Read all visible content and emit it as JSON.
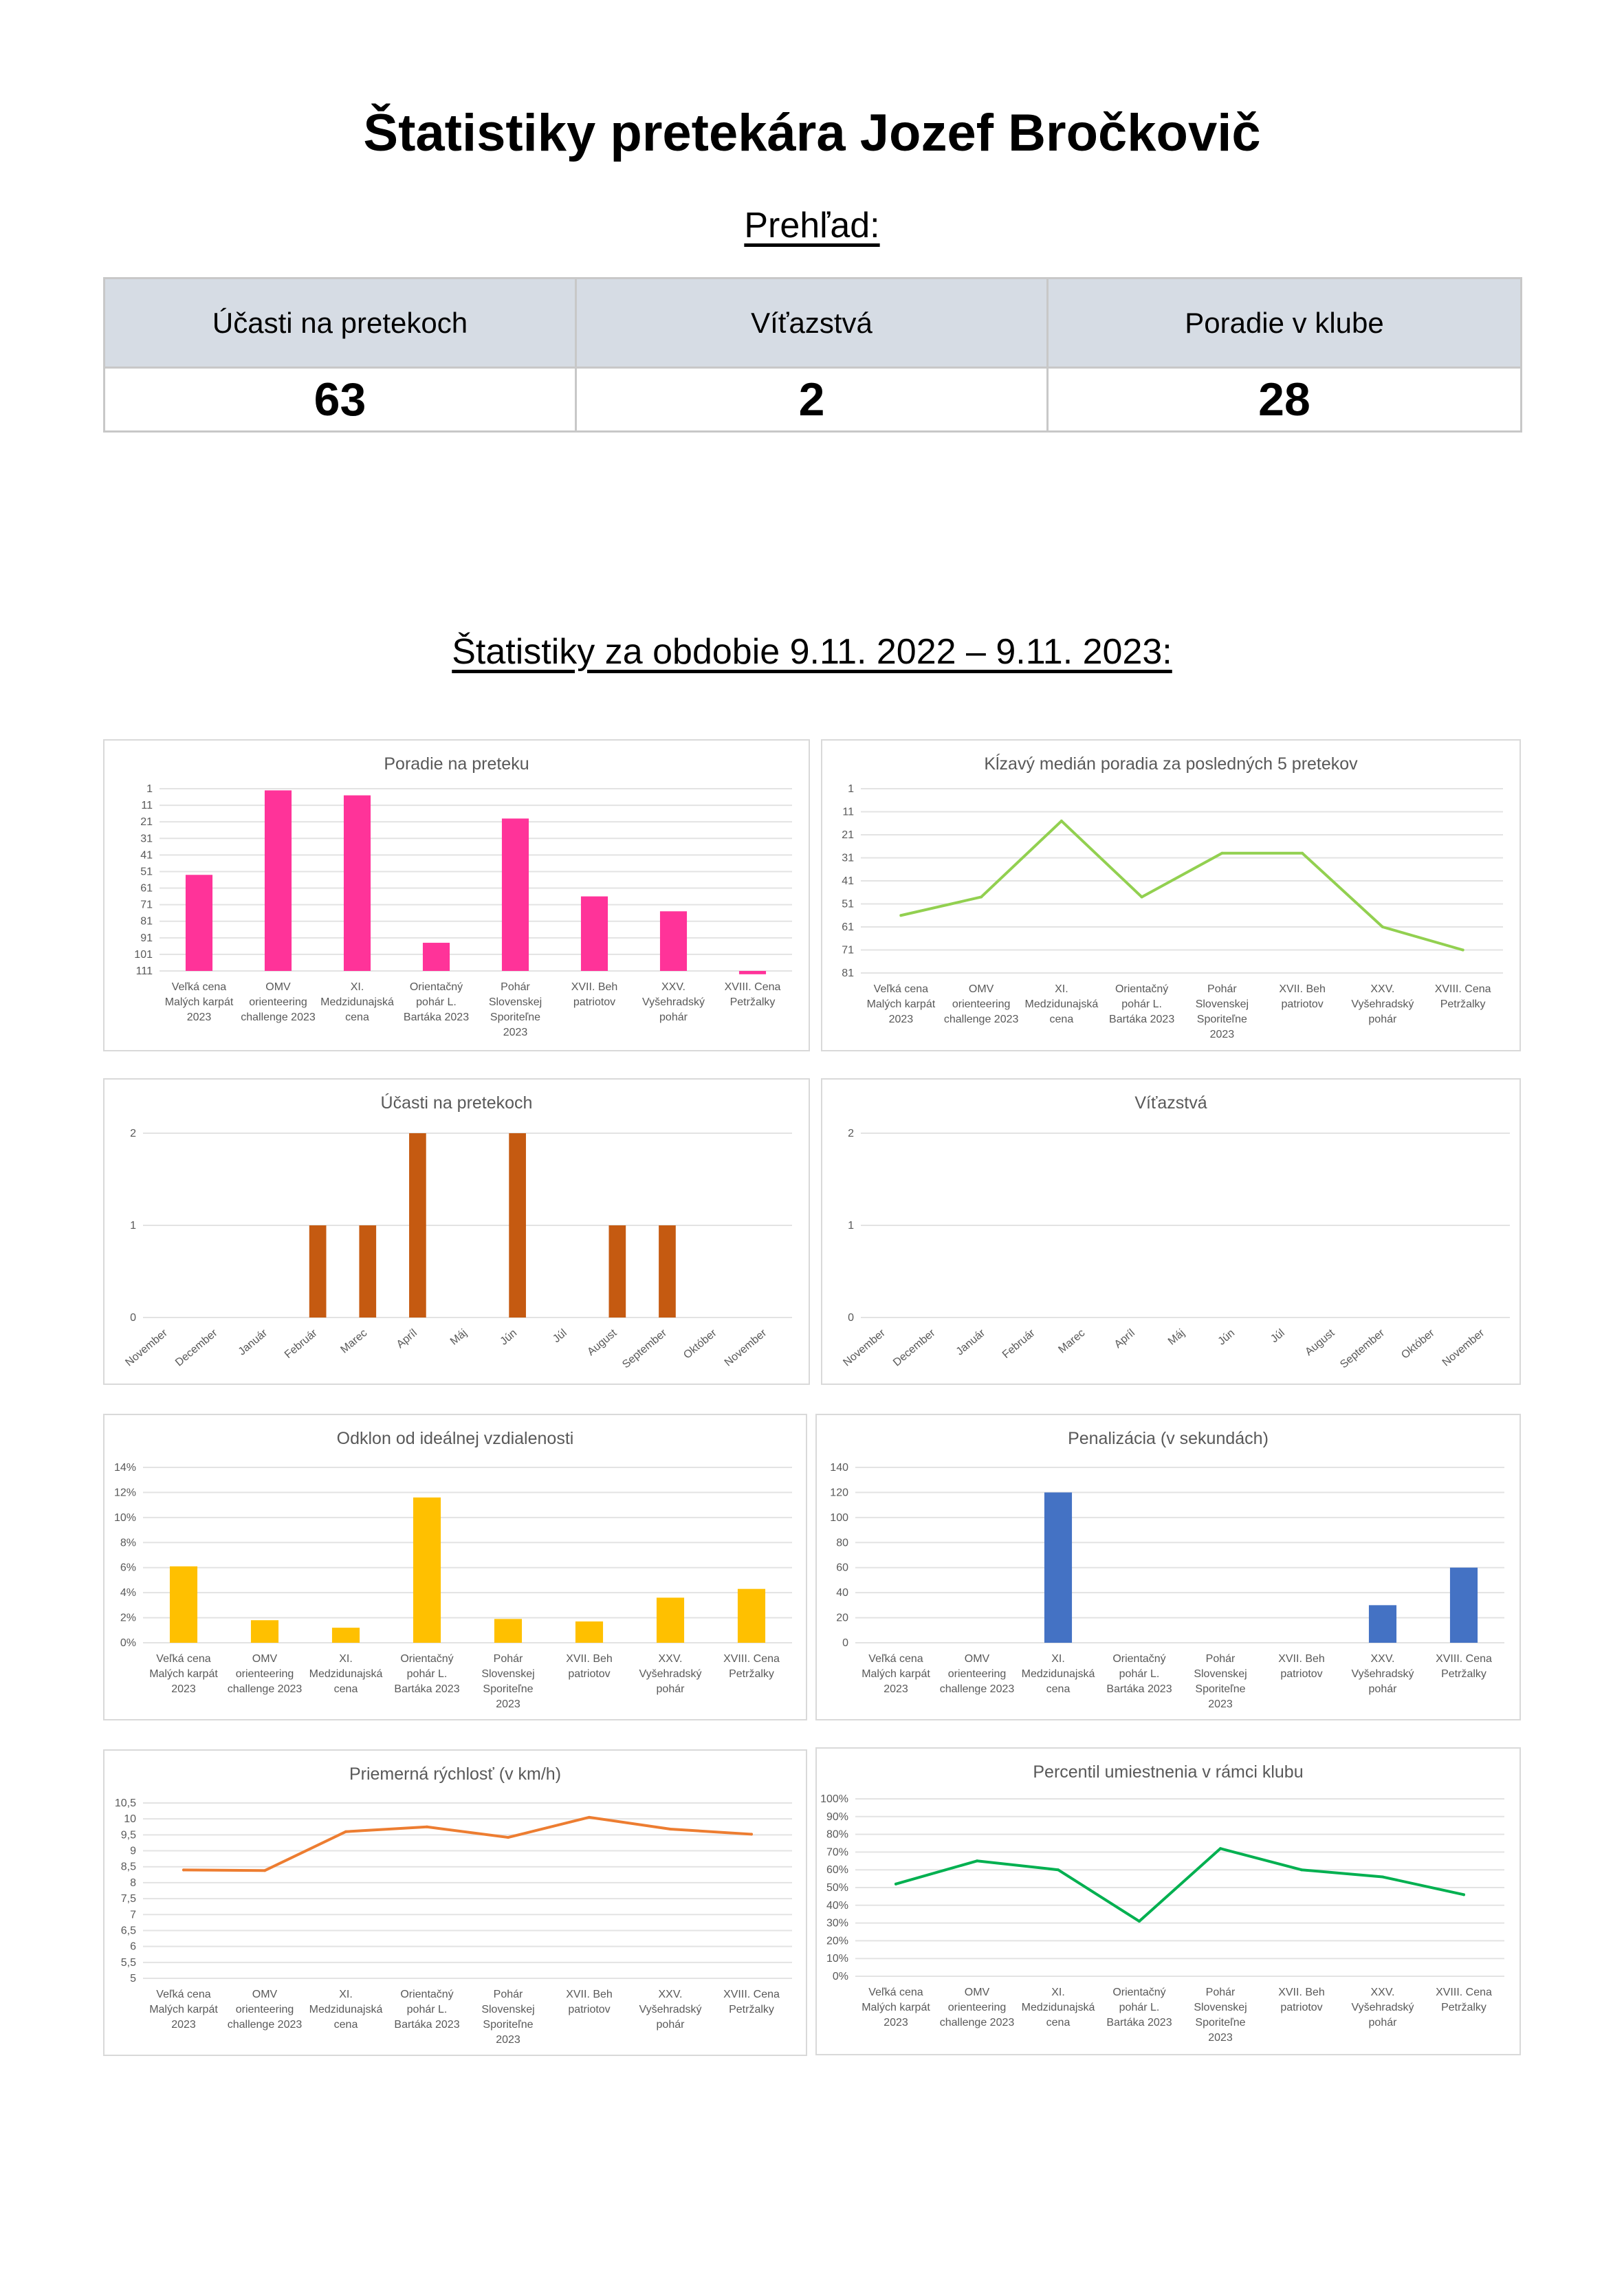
{
  "page": {
    "title": "Štatistiky pretekára Jozef Bročkovič",
    "overview_heading": "Prehľad:",
    "period_heading": "Štatistiky za obdobie 9.11. 2022 – 9.11. 2023:"
  },
  "summary": {
    "headers": [
      "Účasti na pretekoch",
      "Víťazstvá",
      "Poradie v klube"
    ],
    "values": [
      "63",
      "2",
      "28"
    ]
  },
  "races": [
    [
      "Veľká cena",
      "Malých karpát",
      "2023"
    ],
    [
      "OMV",
      "orienteering",
      "challenge 2023"
    ],
    [
      "XI.",
      "Medzidunajská",
      "cena"
    ],
    [
      "Orientačný",
      "pohár L.",
      "Bartáka 2023"
    ],
    [
      "Pohár",
      "Slovenskej",
      "Sporiteľne",
      "2023"
    ],
    [
      "XVII. Beh",
      "patriotov"
    ],
    [
      "XXV.",
      "Vyšehradský",
      "pohár"
    ],
    [
      "XVIII. Cena",
      "Petržalky"
    ]
  ],
  "months": [
    "November",
    "December",
    "Január",
    "Február",
    "Marec",
    "Apríl",
    "Máj",
    "Jún",
    "Júl",
    "August",
    "September",
    "Október",
    "November"
  ],
  "chart_data": [
    {
      "type": "bar",
      "title": "Poradie na preteku",
      "categories_ref": "races",
      "values": [
        53,
        2,
        5,
        94,
        19,
        66,
        75,
        113
      ],
      "ylim": [
        1,
        111
      ],
      "y_ticks": [
        "1",
        "11",
        "21",
        "31",
        "41",
        "51",
        "61",
        "71",
        "81",
        "91",
        "101",
        "111"
      ],
      "y_reversed": true,
      "color": "#ff3399"
    },
    {
      "type": "line",
      "title": "Kĺzavý medián poradia za posledných 5 pretekov",
      "categories_ref": "races",
      "values": [
        56,
        48,
        15,
        48,
        29,
        29,
        61,
        71
      ],
      "ylim": [
        1,
        81
      ],
      "y_ticks": [
        "1",
        "11",
        "21",
        "31",
        "41",
        "51",
        "61",
        "71",
        "81"
      ],
      "y_reversed": true,
      "color": "#92d050"
    },
    {
      "type": "bar",
      "title": "Účasti na pretekoch",
      "categories_ref": "months",
      "values": [
        0,
        0,
        0,
        1,
        1,
        2,
        0,
        2,
        0,
        1,
        1,
        0,
        0
      ],
      "ylim": [
        0,
        2
      ],
      "y_ticks": [
        "0",
        "1",
        "2"
      ],
      "color": "#c55a11"
    },
    {
      "type": "bar",
      "title": "Víťazstvá",
      "categories_ref": "months",
      "values": [
        0,
        0,
        0,
        0,
        0,
        0,
        0,
        0,
        0,
        0,
        0,
        0,
        0
      ],
      "ylim": [
        0,
        2
      ],
      "y_ticks": [
        "0",
        "1",
        "2"
      ],
      "color": "#4472c4"
    },
    {
      "type": "bar",
      "title": "Odklon od ideálnej vzdialenosti",
      "categories_ref": "races",
      "values": [
        6.1,
        1.8,
        1.2,
        11.6,
        1.9,
        1.7,
        3.6,
        4.3
      ],
      "ylim": [
        0,
        14
      ],
      "y_ticks": [
        "0%",
        "2%",
        "4%",
        "6%",
        "8%",
        "10%",
        "12%",
        "14%"
      ],
      "color": "#ffc000"
    },
    {
      "type": "bar",
      "title": "Penalizácia  (v sekundách)",
      "categories_ref": "races",
      "values": [
        0,
        0,
        120,
        0,
        0,
        0,
        30,
        60
      ],
      "ylim": [
        0,
        140
      ],
      "y_ticks": [
        "0",
        "20",
        "40",
        "60",
        "80",
        "100",
        "120",
        "140"
      ],
      "color": "#4472c4"
    },
    {
      "type": "line",
      "title": "Priemerná rýchlosť (v km/h)",
      "categories_ref": "races",
      "values": [
        8.4,
        8.38,
        9.6,
        9.75,
        9.42,
        10.05,
        9.68,
        9.52
      ],
      "ylim": [
        5,
        10.5
      ],
      "y_ticks": [
        "5",
        "5,5",
        "6",
        "6,5",
        "7",
        "7,5",
        "8",
        "8,5",
        "9",
        "9,5",
        "10",
        "10,5"
      ],
      "color": "#ed7d31"
    },
    {
      "type": "line",
      "title": "Percentil umiestnenia v rámci klubu",
      "categories_ref": "races",
      "values": [
        52,
        65,
        60,
        31,
        72,
        60,
        56,
        46
      ],
      "ylim": [
        0,
        100
      ],
      "y_ticks": [
        "0%",
        "10%",
        "20%",
        "30%",
        "40%",
        "50%",
        "60%",
        "70%",
        "80%",
        "90%",
        "100%"
      ],
      "color": "#00b050"
    }
  ]
}
